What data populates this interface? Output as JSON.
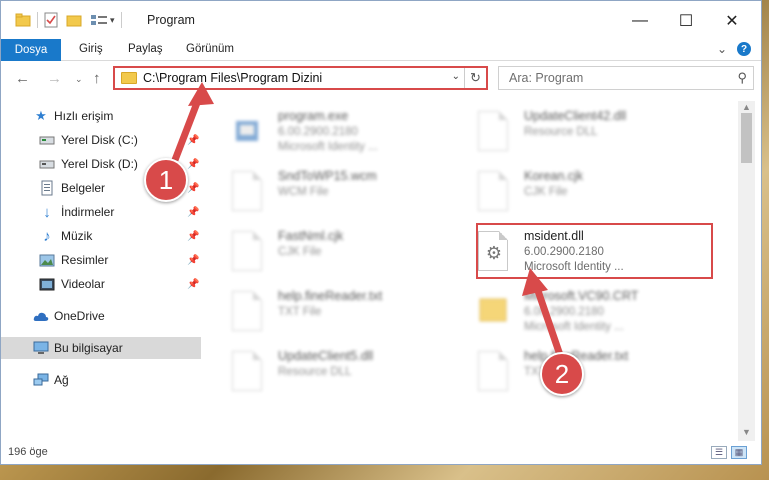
{
  "window": {
    "title": "Program"
  },
  "ribbon": {
    "tabs": [
      "Dosya",
      "Giriş",
      "Paylaş",
      "Görünüm"
    ]
  },
  "nav": {
    "address": "C:\\Program Files\\Program Dizini",
    "search_placeholder": "Ara: Program"
  },
  "sidebar": {
    "items": [
      {
        "label": "Hızlı erişim",
        "icon": "star-icon"
      },
      {
        "label": "Yerel Disk (C:)",
        "icon": "drive-icon",
        "pinned": true
      },
      {
        "label": "Yerel Disk (D:)",
        "icon": "drive-icon",
        "pinned": true
      },
      {
        "label": "Belgeler",
        "icon": "documents-icon",
        "pinned": true
      },
      {
        "label": "İndirmeler",
        "icon": "download-icon",
        "pinned": true
      },
      {
        "label": "Müzik",
        "icon": "music-icon",
        "pinned": true
      },
      {
        "label": "Resimler",
        "icon": "pictures-icon",
        "pinned": true
      },
      {
        "label": "Videolar",
        "icon": "videos-icon",
        "pinned": true
      },
      {
        "label": "OneDrive",
        "icon": "cloud-icon"
      },
      {
        "label": "Bu bilgisayar",
        "icon": "computer-icon",
        "selected": true
      },
      {
        "label": "Ağ",
        "icon": "network-icon"
      }
    ]
  },
  "files": [
    {
      "name": "program.exe",
      "line1": "6.00.2900.2180",
      "line2": "Microsoft Identity ..."
    },
    {
      "name": "UpdateClient42.dll",
      "line1": "Resource DLL",
      "line2": ""
    },
    {
      "name": "SndToWP15.wcm",
      "line1": "WCM File",
      "line2": ""
    },
    {
      "name": "Korean.cjk",
      "line1": "CJK File",
      "line2": ""
    },
    {
      "name": "FastNml.cjk",
      "line1": "CJK File",
      "line2": ""
    },
    {
      "name": "msident.dll",
      "line1": "6.00.2900.2180",
      "line2": "Microsoft Identity ..."
    },
    {
      "name": "help.fineReader.txt",
      "line1": "TXT File",
      "line2": ""
    },
    {
      "name": "Microsoft.VC90.CRT",
      "line1": "6.00.2900.2180",
      "line2": "Microsoft Identity ..."
    },
    {
      "name": "UpdateClient5.dll",
      "line1": "Resource DLL",
      "line2": ""
    },
    {
      "name": "help.fineReader.txt",
      "line1": "TXT File",
      "line2": ""
    }
  ],
  "status": {
    "count": "196 öge"
  },
  "callouts": [
    "1",
    "2"
  ],
  "colors": {
    "accent": "#1979ca",
    "highlight": "#d84a4a"
  }
}
